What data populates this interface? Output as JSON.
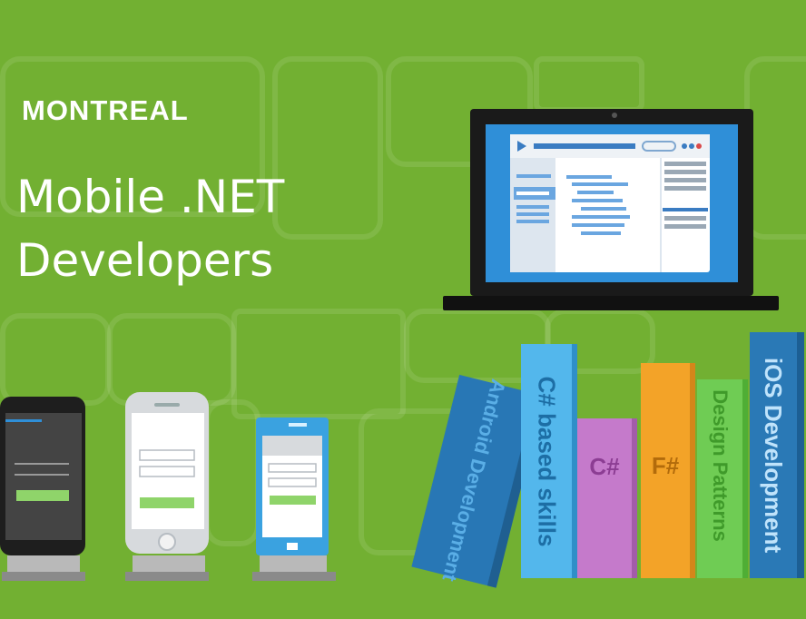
{
  "brand": {
    "city": "MONTREAL"
  },
  "title": {
    "line1": "Mobile .NET",
    "line2": "Developers"
  },
  "books": [
    {
      "label": "Android Development",
      "color": "#2877b5",
      "text_color": "#5aaee6"
    },
    {
      "label": "C# based skills",
      "color": "#53b7ec",
      "text_color": "#1d6ea5"
    },
    {
      "label": "C#",
      "color": "#c57acb",
      "text_color": "#8c3d93"
    },
    {
      "label": "F#",
      "color": "#f3a328",
      "text_color": "#b26b0b"
    },
    {
      "label": "Design Patterns",
      "color": "#6fcc54",
      "text_color": "#3f9a2a"
    },
    {
      "label": "iOS Development",
      "color": "#2a79b6",
      "text_color": "#bfe3fb"
    }
  ],
  "colors": {
    "background": "#72b032",
    "laptop": "#1a1a1a",
    "screen": "#2f8fd8"
  }
}
